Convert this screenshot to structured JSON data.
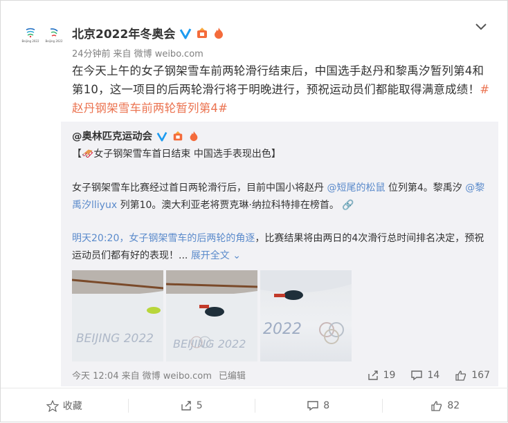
{
  "post": {
    "author": "北京2022年冬奥会",
    "time": "24分钟前",
    "source_prefix": "来自",
    "source": "微博 weibo.com",
    "text_main": "在今天上午的女子钢架雪车前两轮滑行结束后，中国选手赵丹和黎禹汐暂列第4和第10，这一项目的后两轮滑行将于明晚进行，预祝运动员们都能取得满意成绩！",
    "hashtag": "#赵丹钢架雪车前两轮暂列第4#",
    "avatar_caption_1": "Beijing 2022",
    "avatar_caption_2": "Beijing 2022"
  },
  "repost": {
    "author": "@奥林匹克运动会",
    "title": "【🛷女子钢架雪车首日结束 中国选手表现出色】",
    "body1_a": "女子钢架雪车比赛经过首日两轮滑行后，目前中国小将赵丹 ",
    "mention1": "@短尾的松鼠",
    "body1_b": " 位列第4。黎禹汐 ",
    "mention2": "@黎禹汐lliyux",
    "body1_c": " 列第10。澳大利亚老将贾克琳·纳拉科特排在榜首。",
    "body2_link": "明天20:20，女子钢架雪车的后两轮的角逐",
    "body2_text": "，比赛结果将由两日的4次滑行总时间排名决定，预祝运动员们都有好的表现！... ",
    "expand": "展开全文",
    "images": [
      {
        "caption": "BEIJING 2022"
      },
      {
        "caption": "BEIJING 2022"
      },
      {
        "caption": "2022"
      }
    ],
    "time": "今天 12:04",
    "source_prefix": "来自",
    "source": "微博 weibo.com",
    "edited": "已编辑",
    "shares": "19",
    "comments": "14",
    "likes": "167"
  },
  "actions": {
    "favorite": "收藏",
    "share": "5",
    "comment": "8",
    "like": "82"
  },
  "colors": {
    "link": "#eb7350",
    "mention": "#5a8acb",
    "verified": "#1d9bf0",
    "repost_bg": "#f2f2f5"
  }
}
